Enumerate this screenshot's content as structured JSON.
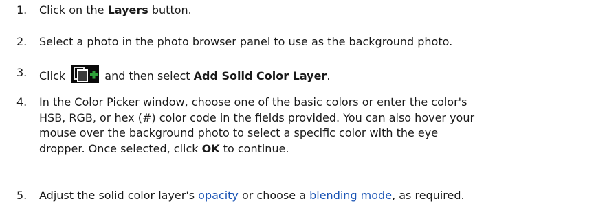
{
  "steps": [
    {
      "number": "1.",
      "before": "Click on the ",
      "bold": "Layers",
      "after": " button."
    },
    {
      "number": "2.",
      "text": "Select a photo in the photo browser panel to use as the background photo."
    },
    {
      "number": "3.",
      "before": "Click ",
      "icon": "add-layer-icon",
      "middle": " and then select ",
      "bold": "Add Solid Color Layer",
      "after": "."
    },
    {
      "number": "4.",
      "lines": [
        "In the Color Picker window, choose one of the basic colors or enter the color's",
        "HSB, RGB, or hex (#) color code in the fields provided. You can also hover your",
        "mouse over the background photo to select a specific color with the eye"
      ],
      "last_before": "dropper. Once selected, click ",
      "bold": "OK",
      "last_after": " to continue."
    },
    {
      "number": "5.",
      "before": "Adjust the solid color layer's ",
      "link1": "opacity",
      "middle": " or choose a ",
      "link2": "blending mode",
      "after": ", as required."
    }
  ],
  "colors": {
    "text": "#1a1a1a",
    "link": "#1a54b5",
    "icon_bg": "#0a0a0a",
    "icon_plus": "#2fa03a"
  }
}
